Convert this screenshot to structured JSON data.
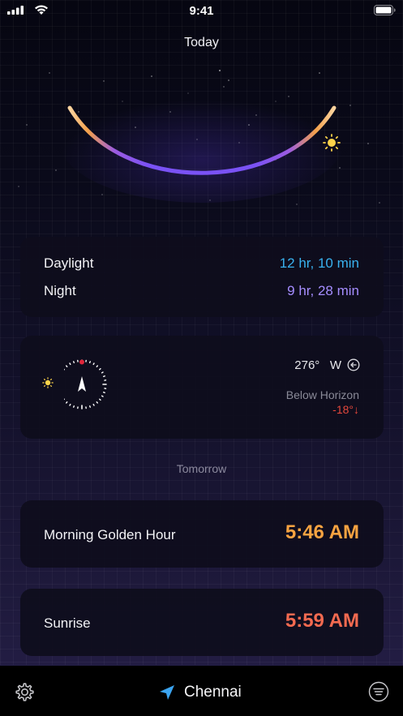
{
  "status_bar": {
    "time": "9:41"
  },
  "today": {
    "title": "Today"
  },
  "day_night": {
    "daylight_label": "Daylight",
    "daylight_value": "12 hr, 10 min",
    "night_label": "Night",
    "night_value": "9 hr, 28 min"
  },
  "sun_position": {
    "azimuth": "276°",
    "direction": "W",
    "horizon_label": "Below Horizon",
    "elevation": "-18°↓"
  },
  "tomorrow": {
    "title": "Tomorrow",
    "golden_hour_label": "Morning Golden Hour",
    "golden_hour_time": "5:46 AM",
    "sunrise_label": "Sunrise",
    "sunrise_time": "5:59 AM"
  },
  "bottom_bar": {
    "location": "Chennai"
  },
  "colors": {
    "daylight": "#39b2ef",
    "night": "#a58dff",
    "golden": "#f7a341",
    "sunrise": "#f36a50",
    "below_horizon": "#e5483c",
    "arc_purple": "#7a52f5",
    "arc_orange": "#f5a04a"
  },
  "icons": [
    "signal-icon",
    "wifi-icon",
    "battery-icon",
    "sun-icon",
    "compass-icon",
    "back-circle-icon",
    "settings-icon",
    "location-arrow-icon",
    "menu-icon"
  ]
}
